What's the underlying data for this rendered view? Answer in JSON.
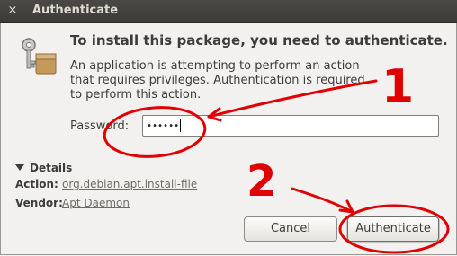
{
  "window": {
    "title": "Authenticate",
    "close_glyph": "×"
  },
  "dialog": {
    "heading": "To install this package, you need to authenticate.",
    "message": "An application is attempting to perform an action that requires privileges. Authentication is required to perform this action.",
    "password_label": "Password:",
    "password_value": "••••••",
    "details": {
      "toggle_label": "Details",
      "action_label": "Action:",
      "action_value": "org.debian.apt.install-file",
      "vendor_label": "Vendor:",
      "vendor_value": "Apt Daemon"
    },
    "buttons": {
      "cancel": "Cancel",
      "authenticate": "Authenticate"
    }
  },
  "annotations": {
    "label_1": "1",
    "label_2": "2",
    "color": "#e00000"
  },
  "icons": [
    "close-icon",
    "keys-package-icon",
    "details-expander-icon"
  ]
}
